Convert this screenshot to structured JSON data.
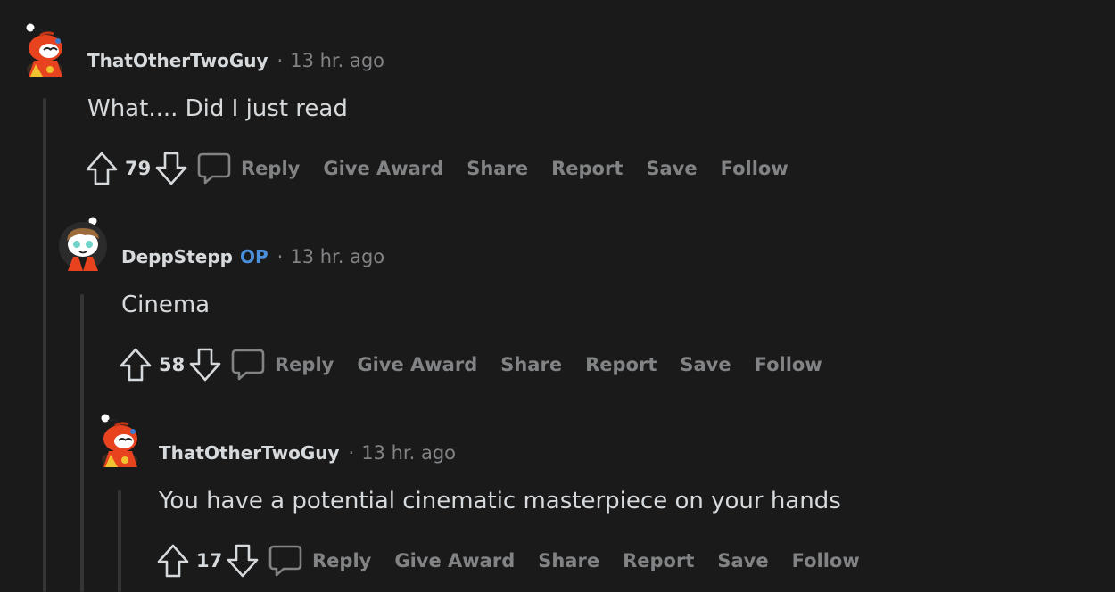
{
  "comments": [
    {
      "username": "ThatOtherTwoGuy",
      "op_badge": "",
      "separator": "·",
      "timestamp": "13 hr. ago",
      "body": "What.... Did I just read",
      "score": "79",
      "avatar": "snoo-avatar-red",
      "actions": {
        "reply": "Reply",
        "give_award": "Give Award",
        "share": "Share",
        "report": "Report",
        "save": "Save",
        "follow": "Follow"
      }
    },
    {
      "username": "DeppStepp",
      "op_badge": "OP",
      "separator": "·",
      "timestamp": "13 hr. ago",
      "body": "Cinema",
      "score": "58",
      "avatar": "snoo-avatar-brown-hair",
      "actions": {
        "reply": "Reply",
        "give_award": "Give Award",
        "share": "Share",
        "report": "Report",
        "save": "Save",
        "follow": "Follow"
      }
    },
    {
      "username": "ThatOtherTwoGuy",
      "op_badge": "",
      "separator": "·",
      "timestamp": "13 hr. ago",
      "body": "You have a potential cinematic masterpiece on your hands",
      "score": "17",
      "avatar": "snoo-avatar-red",
      "actions": {
        "reply": "Reply",
        "give_award": "Give Award",
        "share": "Share",
        "report": "Report",
        "save": "Save",
        "follow": "Follow"
      }
    }
  ],
  "colors": {
    "background": "#1a1a1b",
    "text": "#d7dadc",
    "muted": "#818384",
    "op_badge": "#4a8fdb",
    "thread_line": "#343536",
    "snoo_red": "#e8431f"
  }
}
